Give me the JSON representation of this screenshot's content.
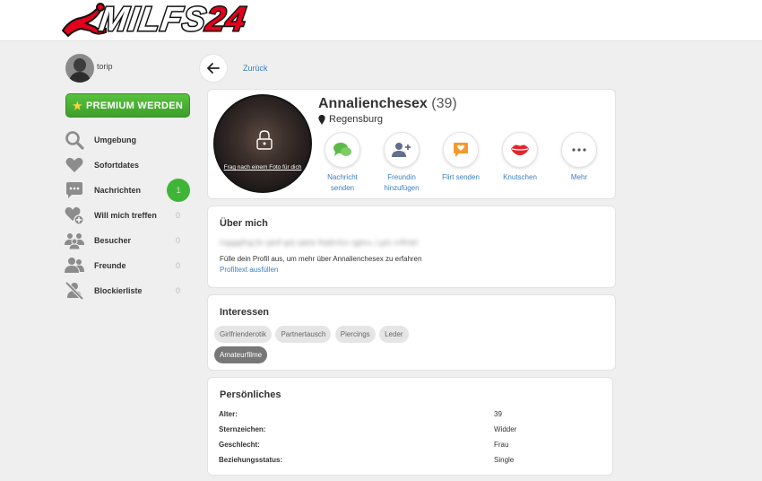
{
  "header": {
    "logo_text": "MILFS",
    "logo_number": "24"
  },
  "sidebar": {
    "username": "torip",
    "premium_label": "PREMIUM WERDEN",
    "items": [
      {
        "label": "Umgebung",
        "count": ""
      },
      {
        "label": "Sofortdates",
        "count": ""
      },
      {
        "label": "Nachrichten",
        "count": "1"
      },
      {
        "label": "Will mich treffen",
        "count": "0"
      },
      {
        "label": "Besucher",
        "count": "0"
      },
      {
        "label": "Freunde",
        "count": "0"
      },
      {
        "label": "Blockierliste",
        "count": "0"
      }
    ]
  },
  "back": {
    "label": "Zurück"
  },
  "profile": {
    "name": "Annalienchesex",
    "age": "(39)",
    "city": "Regensburg",
    "photo_link": "Frag nach einem Foto für dich",
    "actions": [
      {
        "label": "Nachricht senden",
        "icon": "chat-bubbles-icon"
      },
      {
        "label": "Freundin hinzufügen",
        "icon": "add-friend-icon"
      },
      {
        "label": "Flirt senden",
        "icon": "flirt-heart-icon"
      },
      {
        "label": "Knutschen",
        "icon": "lips-icon"
      },
      {
        "label": "Mehr",
        "icon": "more-dots-icon"
      }
    ]
  },
  "about": {
    "title": "Über mich",
    "prompt": "Fülle dein Profil aus, um mehr über Annalienchesex zu erfahren",
    "link": "Profiltext ausfüllen"
  },
  "interests": {
    "title": "Interessen",
    "tags": [
      {
        "label": "Girlfrienderotik",
        "active": false
      },
      {
        "label": "Partnertausch",
        "active": false
      },
      {
        "label": "Piercings",
        "active": false
      },
      {
        "label": "Leder",
        "active": false
      },
      {
        "label": "Amateurfilme",
        "active": true
      }
    ]
  },
  "personal": {
    "title": "Persönliches",
    "rows": [
      {
        "key": "Alter:",
        "value": "39"
      },
      {
        "key": "Sternzeichen:",
        "value": "Widder"
      },
      {
        "key": "Geschlecht:",
        "value": "Frau"
      },
      {
        "key": "Beziehungsstatus:",
        "value": "Single"
      }
    ]
  },
  "colors": {
    "accent_green": "#3fb437",
    "link_blue": "#3a7fc1",
    "logo_red": "#e3001b"
  }
}
